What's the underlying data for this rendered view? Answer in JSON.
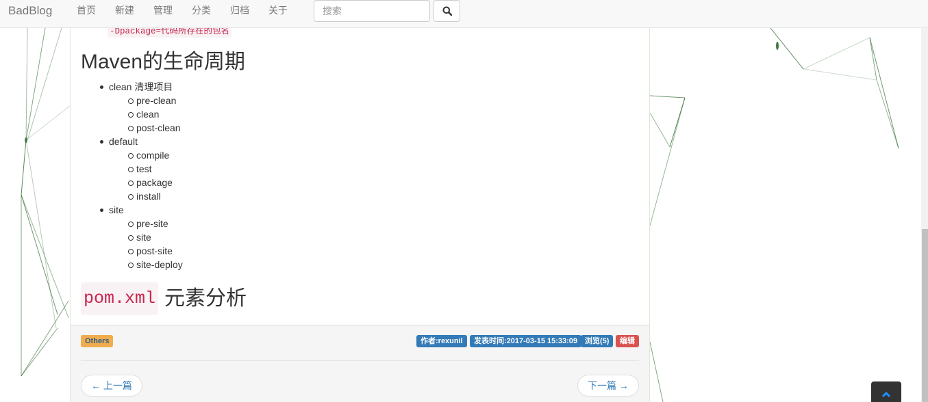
{
  "navbar": {
    "brand": "BadBlog",
    "links": [
      "首页",
      "新建",
      "管理",
      "分类",
      "归档",
      "关于"
    ],
    "search_placeholder": "搜索",
    "search_icon": "search-icon"
  },
  "article": {
    "code_snippet": "-Dpackage=代码所存在的包名",
    "lifecycle_heading": "Maven的生命周期",
    "lifecycle": [
      {
        "label": "clean 清理项目",
        "children": [
          "pre-clean",
          "clean",
          "post-clean"
        ]
      },
      {
        "label": "default",
        "children": [
          "compile",
          "test",
          "package",
          "install"
        ]
      },
      {
        "label": "site",
        "children": [
          "pre-site",
          "site",
          "post-site",
          "site-deploy"
        ]
      }
    ],
    "pom_heading_code": "pom.xml",
    "pom_heading_text": "元素分析"
  },
  "footer": {
    "tag": "Others",
    "author": "作者:rexunil",
    "time": "发表时间:2017-03-15 15:33:09",
    "views": "浏览(5)",
    "edit": "编辑",
    "prev": "← 上一篇",
    "next": "下一篇 →"
  },
  "colors": {
    "accent": "#337ab7",
    "tag": "#f0ad4e",
    "danger": "#d9534f",
    "code": "#c7254e",
    "background_lines": "#2e6b2e"
  },
  "back_to_top_icon": "chevron-up-icon"
}
